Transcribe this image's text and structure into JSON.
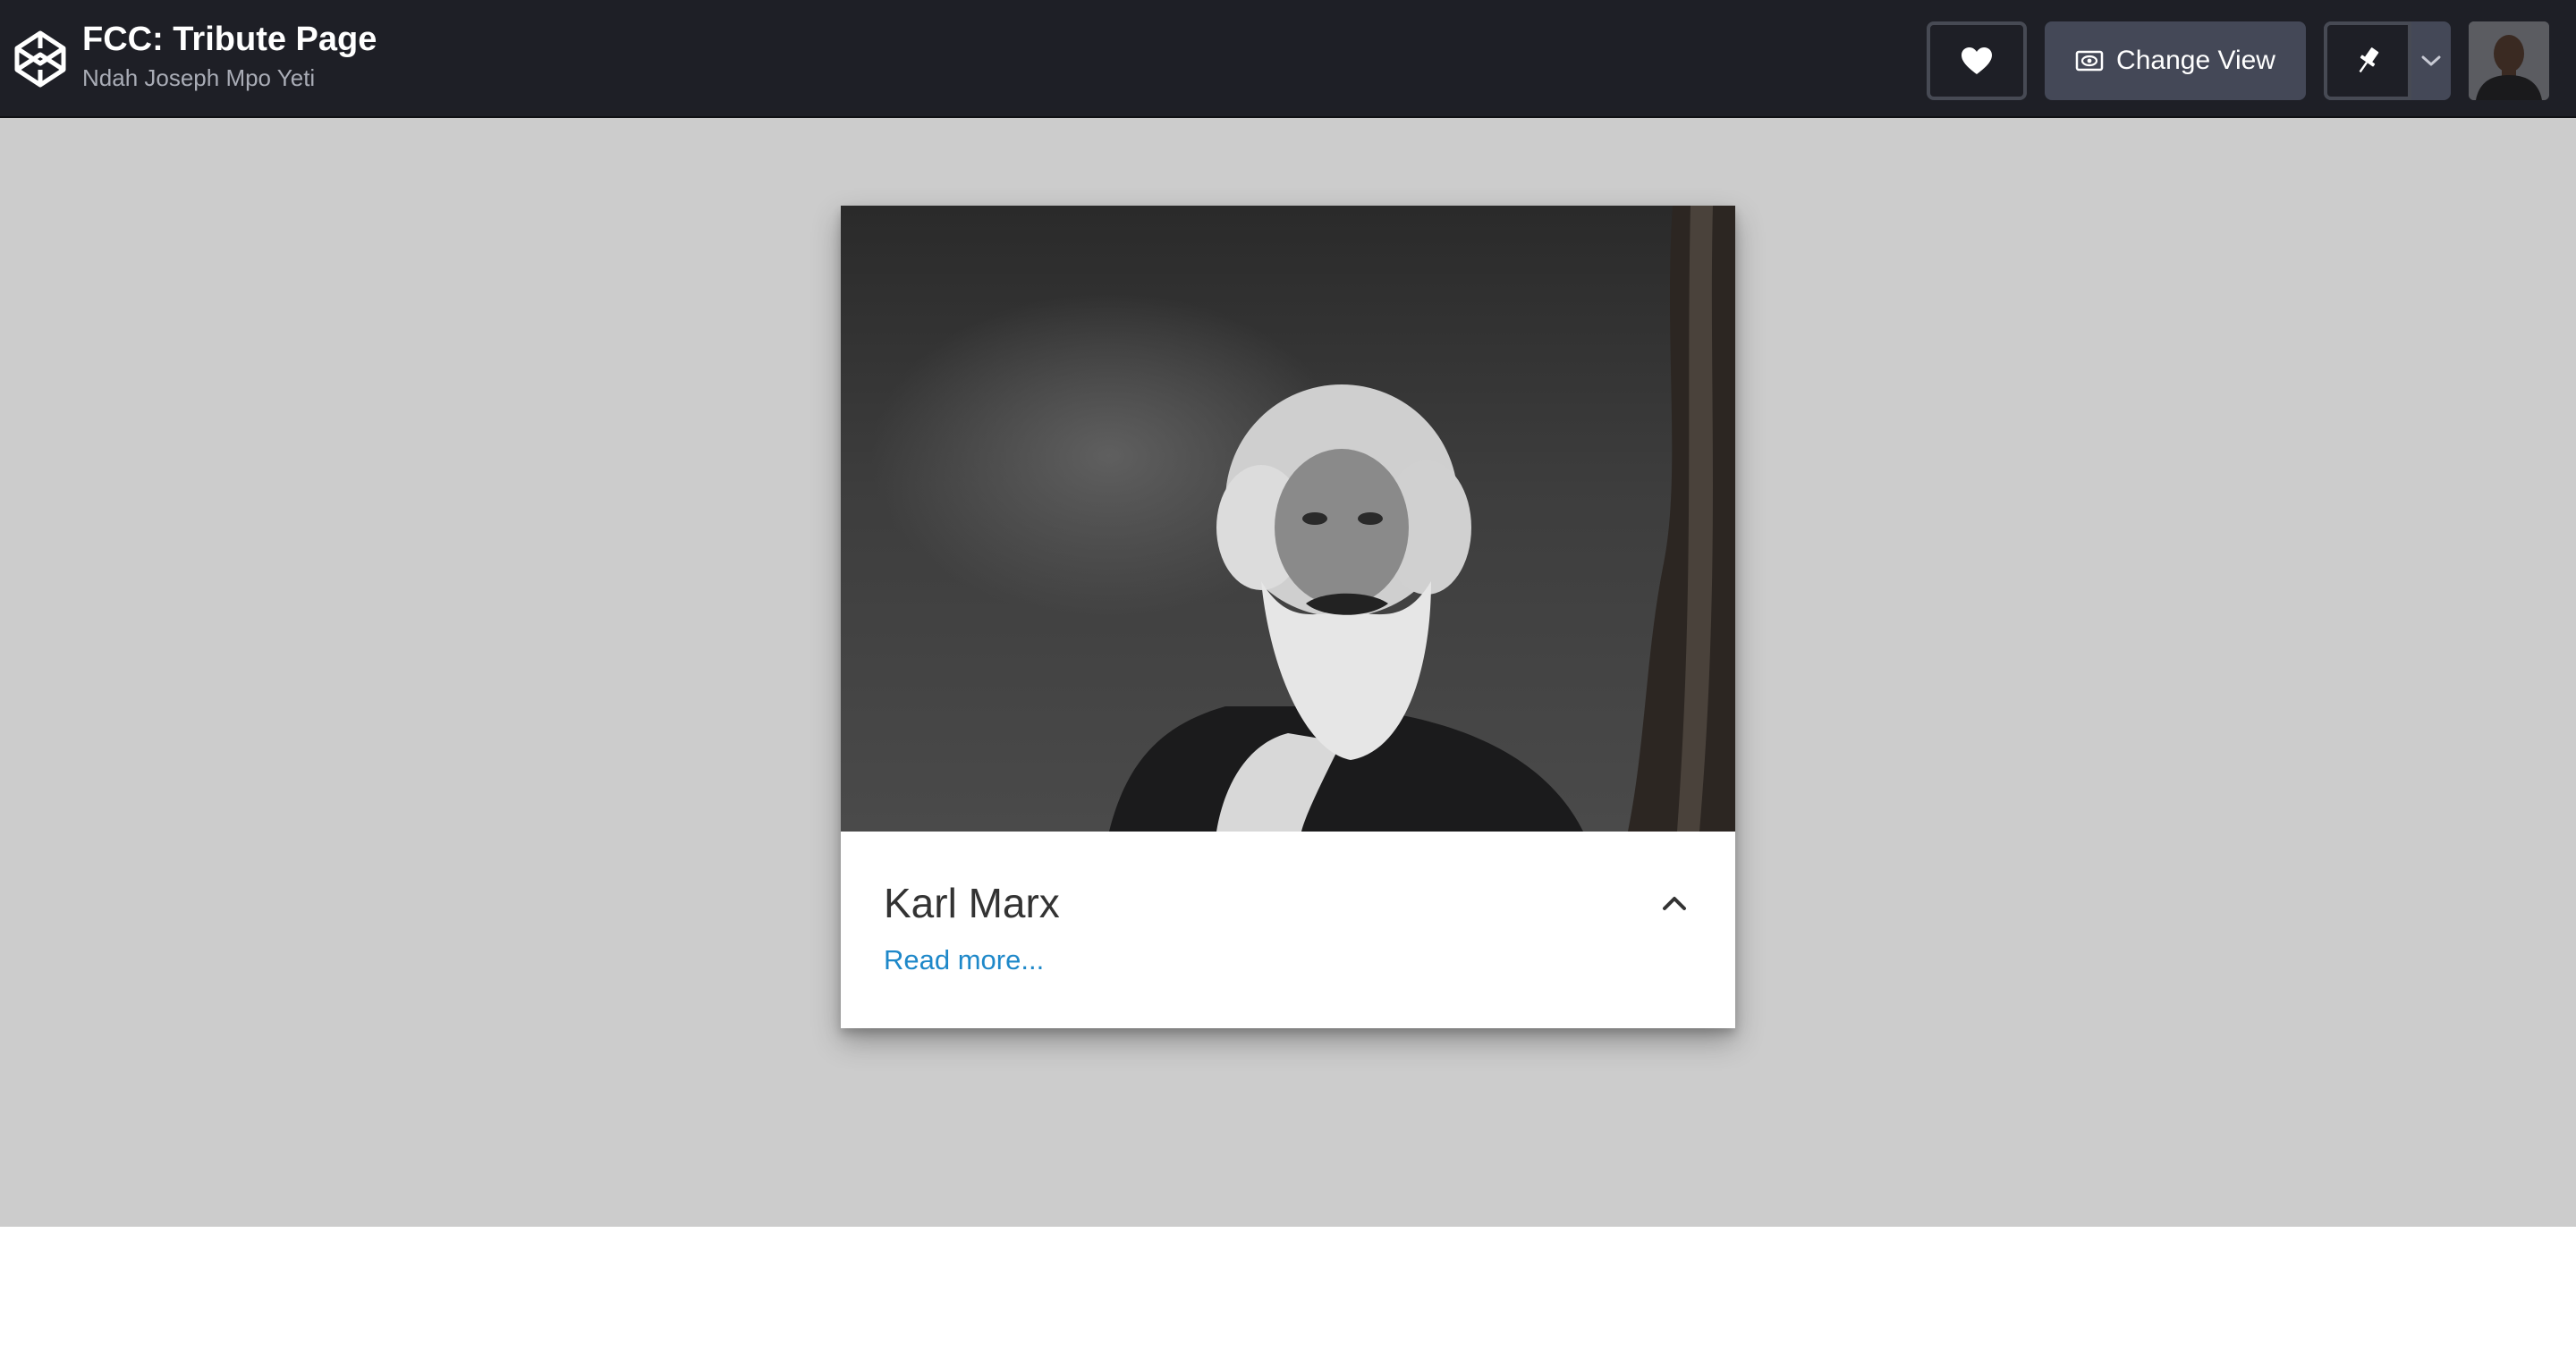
{
  "header": {
    "title": "FCC: Tribute Page",
    "author": "Ndah Joseph Mpo Yeti",
    "logo_icon": "codepen-logo-icon",
    "heart_icon": "heart-icon",
    "change_view_label": "Change View",
    "change_view_icon": "eye-icon",
    "pin_icon": "pin-icon",
    "pin_menu_icon": "chevron-down-icon",
    "avatar_icon": "user-avatar"
  },
  "card": {
    "image_alt": "Karl Marx",
    "title": "Karl Marx",
    "link_text": "Read more...",
    "toggle_icon": "chevron-up-icon"
  },
  "colors": {
    "header_bg": "#1e1f26",
    "button_bg": "#444857",
    "preview_bg": "#cccccc",
    "link": "#1e88c9"
  }
}
